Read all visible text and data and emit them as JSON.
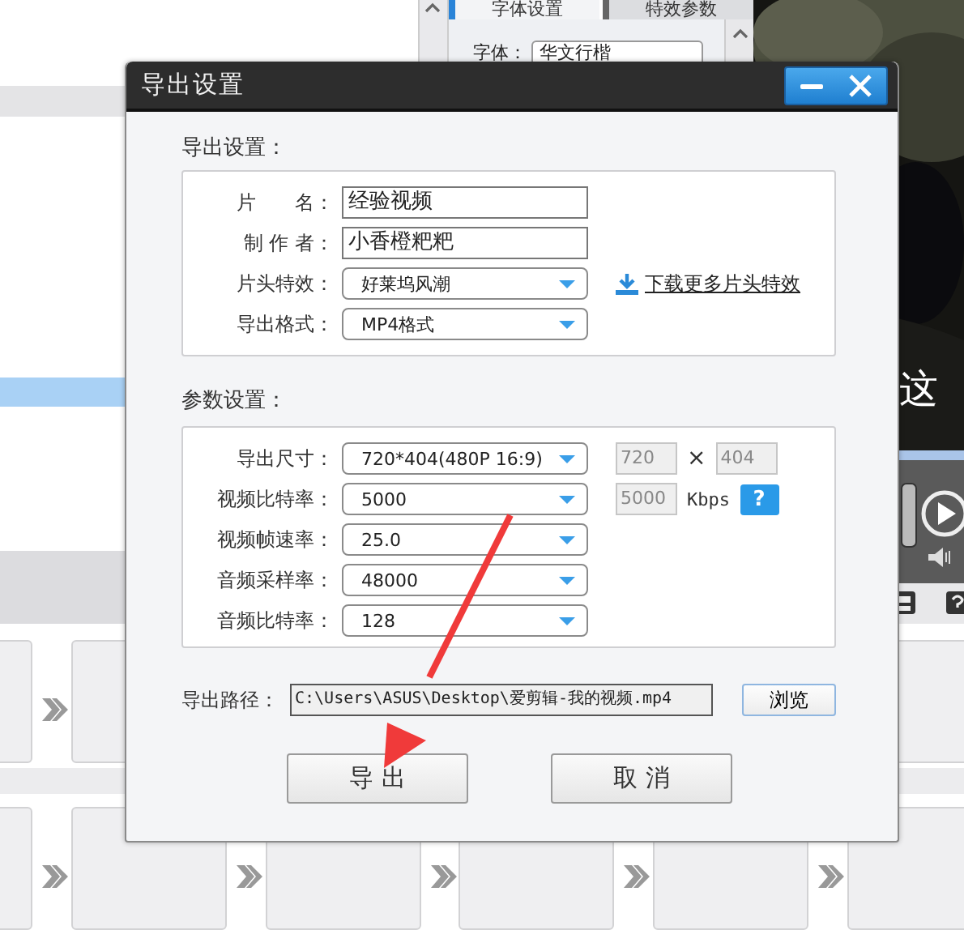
{
  "background": {
    "panel_tabs": [
      {
        "label": "字体设置",
        "selected": true
      },
      {
        "label": "特效参数",
        "selected": false
      }
    ],
    "font_label": "字体：",
    "font_value": "华文行楷",
    "subtitle": "这"
  },
  "dialog": {
    "title": "导出设置",
    "sections": [
      {
        "title": "导出设置：",
        "rows": [
          {
            "label": "片　　名：",
            "kind": "text",
            "value": "经验视频"
          },
          {
            "label": "制 作 者：",
            "kind": "text",
            "value": "小香橙粑粑"
          },
          {
            "label": "片头特效：",
            "kind": "dropdown",
            "value": "好莱坞风潮",
            "link": "下载更多片头特效"
          },
          {
            "label": "导出格式：",
            "kind": "dropdown",
            "value": "MP4格式"
          }
        ]
      },
      {
        "title": "参数设置：",
        "rows": [
          {
            "label": "导出尺寸：",
            "kind": "dropdown",
            "value": "720*404(480P 16:9)",
            "size_fields": [
              "720",
              "404"
            ],
            "separator": "×"
          },
          {
            "label": "视频比特率：",
            "kind": "dropdown",
            "value": "5000",
            "readout": "5000",
            "unit": "Kbps",
            "help": "?"
          },
          {
            "label": "视频帧速率：",
            "kind": "dropdown",
            "value": "25.0"
          },
          {
            "label": "音频采样率：",
            "kind": "dropdown",
            "value": "48000"
          },
          {
            "label": "音频比特率：",
            "kind": "dropdown",
            "value": "128"
          }
        ]
      }
    ],
    "path": {
      "label": "导出路径：",
      "value": "C:\\Users\\ASUS\\Desktop\\爱剪辑-我的视频.mp4",
      "browse": "浏览"
    },
    "buttons": [
      "导 出",
      "取 消"
    ]
  }
}
